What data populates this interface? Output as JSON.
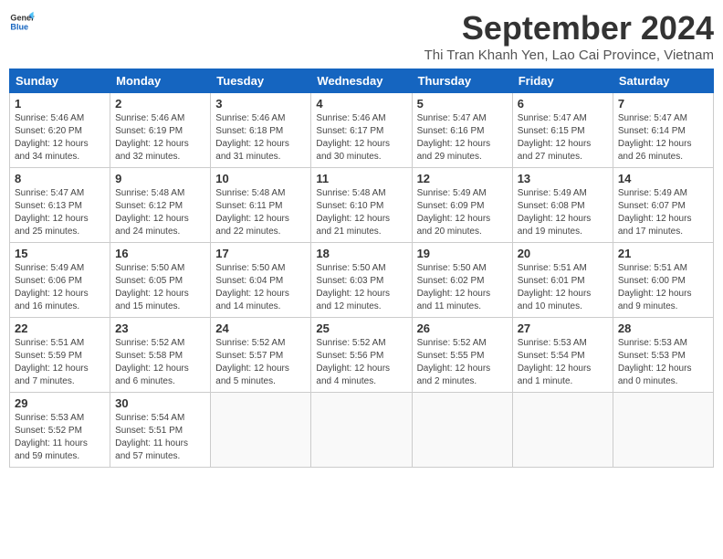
{
  "logo": {
    "line1": "General",
    "line2": "Blue"
  },
  "title": "September 2024",
  "subtitle": "Thi Tran Khanh Yen, Lao Cai Province, Vietnam",
  "weekdays": [
    "Sunday",
    "Monday",
    "Tuesday",
    "Wednesday",
    "Thursday",
    "Friday",
    "Saturday"
  ],
  "weeks": [
    [
      {
        "day": "1",
        "info": "Sunrise: 5:46 AM\nSunset: 6:20 PM\nDaylight: 12 hours\nand 34 minutes."
      },
      {
        "day": "2",
        "info": "Sunrise: 5:46 AM\nSunset: 6:19 PM\nDaylight: 12 hours\nand 32 minutes."
      },
      {
        "day": "3",
        "info": "Sunrise: 5:46 AM\nSunset: 6:18 PM\nDaylight: 12 hours\nand 31 minutes."
      },
      {
        "day": "4",
        "info": "Sunrise: 5:46 AM\nSunset: 6:17 PM\nDaylight: 12 hours\nand 30 minutes."
      },
      {
        "day": "5",
        "info": "Sunrise: 5:47 AM\nSunset: 6:16 PM\nDaylight: 12 hours\nand 29 minutes."
      },
      {
        "day": "6",
        "info": "Sunrise: 5:47 AM\nSunset: 6:15 PM\nDaylight: 12 hours\nand 27 minutes."
      },
      {
        "day": "7",
        "info": "Sunrise: 5:47 AM\nSunset: 6:14 PM\nDaylight: 12 hours\nand 26 minutes."
      }
    ],
    [
      {
        "day": "8",
        "info": "Sunrise: 5:47 AM\nSunset: 6:13 PM\nDaylight: 12 hours\nand 25 minutes."
      },
      {
        "day": "9",
        "info": "Sunrise: 5:48 AM\nSunset: 6:12 PM\nDaylight: 12 hours\nand 24 minutes."
      },
      {
        "day": "10",
        "info": "Sunrise: 5:48 AM\nSunset: 6:11 PM\nDaylight: 12 hours\nand 22 minutes."
      },
      {
        "day": "11",
        "info": "Sunrise: 5:48 AM\nSunset: 6:10 PM\nDaylight: 12 hours\nand 21 minutes."
      },
      {
        "day": "12",
        "info": "Sunrise: 5:49 AM\nSunset: 6:09 PM\nDaylight: 12 hours\nand 20 minutes."
      },
      {
        "day": "13",
        "info": "Sunrise: 5:49 AM\nSunset: 6:08 PM\nDaylight: 12 hours\nand 19 minutes."
      },
      {
        "day": "14",
        "info": "Sunrise: 5:49 AM\nSunset: 6:07 PM\nDaylight: 12 hours\nand 17 minutes."
      }
    ],
    [
      {
        "day": "15",
        "info": "Sunrise: 5:49 AM\nSunset: 6:06 PM\nDaylight: 12 hours\nand 16 minutes."
      },
      {
        "day": "16",
        "info": "Sunrise: 5:50 AM\nSunset: 6:05 PM\nDaylight: 12 hours\nand 15 minutes."
      },
      {
        "day": "17",
        "info": "Sunrise: 5:50 AM\nSunset: 6:04 PM\nDaylight: 12 hours\nand 14 minutes."
      },
      {
        "day": "18",
        "info": "Sunrise: 5:50 AM\nSunset: 6:03 PM\nDaylight: 12 hours\nand 12 minutes."
      },
      {
        "day": "19",
        "info": "Sunrise: 5:50 AM\nSunset: 6:02 PM\nDaylight: 12 hours\nand 11 minutes."
      },
      {
        "day": "20",
        "info": "Sunrise: 5:51 AM\nSunset: 6:01 PM\nDaylight: 12 hours\nand 10 minutes."
      },
      {
        "day": "21",
        "info": "Sunrise: 5:51 AM\nSunset: 6:00 PM\nDaylight: 12 hours\nand 9 minutes."
      }
    ],
    [
      {
        "day": "22",
        "info": "Sunrise: 5:51 AM\nSunset: 5:59 PM\nDaylight: 12 hours\nand 7 minutes."
      },
      {
        "day": "23",
        "info": "Sunrise: 5:52 AM\nSunset: 5:58 PM\nDaylight: 12 hours\nand 6 minutes."
      },
      {
        "day": "24",
        "info": "Sunrise: 5:52 AM\nSunset: 5:57 PM\nDaylight: 12 hours\nand 5 minutes."
      },
      {
        "day": "25",
        "info": "Sunrise: 5:52 AM\nSunset: 5:56 PM\nDaylight: 12 hours\nand 4 minutes."
      },
      {
        "day": "26",
        "info": "Sunrise: 5:52 AM\nSunset: 5:55 PM\nDaylight: 12 hours\nand 2 minutes."
      },
      {
        "day": "27",
        "info": "Sunrise: 5:53 AM\nSunset: 5:54 PM\nDaylight: 12 hours\nand 1 minute."
      },
      {
        "day": "28",
        "info": "Sunrise: 5:53 AM\nSunset: 5:53 PM\nDaylight: 12 hours\nand 0 minutes."
      }
    ],
    [
      {
        "day": "29",
        "info": "Sunrise: 5:53 AM\nSunset: 5:52 PM\nDaylight: 11 hours\nand 59 minutes."
      },
      {
        "day": "30",
        "info": "Sunrise: 5:54 AM\nSunset: 5:51 PM\nDaylight: 11 hours\nand 57 minutes."
      },
      {
        "day": "",
        "info": ""
      },
      {
        "day": "",
        "info": ""
      },
      {
        "day": "",
        "info": ""
      },
      {
        "day": "",
        "info": ""
      },
      {
        "day": "",
        "info": ""
      }
    ]
  ]
}
